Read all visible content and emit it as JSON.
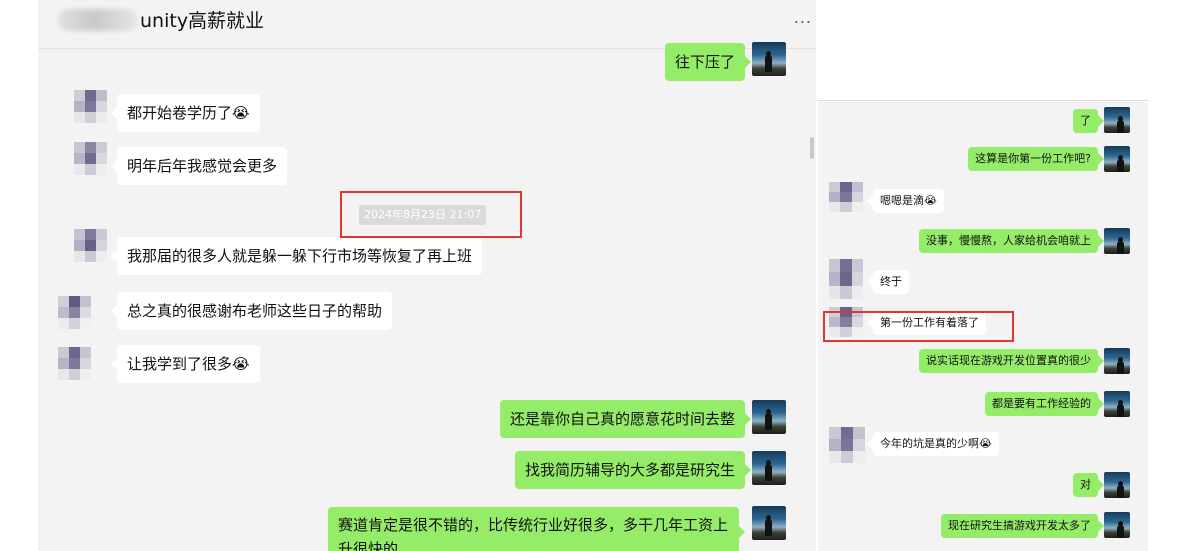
{
  "header": {
    "title": "unity高薪就业",
    "more": "..."
  },
  "left_chat": {
    "messages": [
      {
        "side": "right",
        "text": "往下压了"
      },
      {
        "side": "left",
        "text": "都开始卷学历了😭"
      },
      {
        "side": "left",
        "text": "明年后年我感觉会更多"
      },
      {
        "side": "left",
        "text": "我那届的很多人就是躲一躲下行市场等恢复了再上班"
      },
      {
        "side": "left",
        "text": "总之真的很感谢布老师这些日子的帮助"
      },
      {
        "side": "left",
        "text": "让我学到了很多😭"
      },
      {
        "side": "right",
        "text": "还是靠你自己真的愿意花时间去整"
      },
      {
        "side": "right",
        "text": "找我简历辅导的大多都是研究生"
      },
      {
        "side": "right",
        "text": "赛道肯定是很不错的，比传统行业好很多，多干几年工资上升很快的"
      }
    ],
    "timestamp": "2024年8月23日 21:07"
  },
  "right_chat": {
    "messages": [
      {
        "side": "right",
        "text": "了"
      },
      {
        "side": "right",
        "text": "这算是你第一份工作吧?"
      },
      {
        "side": "left",
        "text": "嗯嗯是滴😭"
      },
      {
        "side": "right",
        "text": "没事，慢慢熬，人家给机会咱就上"
      },
      {
        "side": "left",
        "text": "终于"
      },
      {
        "side": "left",
        "text": "第一份工作有着落了"
      },
      {
        "side": "right",
        "text": "说实话现在游戏开发位置真的很少"
      },
      {
        "side": "right",
        "text": "都是要有工作经验的"
      },
      {
        "side": "left",
        "text": "今年的坑是真的少啊😭"
      },
      {
        "side": "right",
        "text": "对"
      },
      {
        "side": "right",
        "text": "现在研究生搞游戏开发太多了"
      }
    ]
  },
  "colors": {
    "self_bubble": "#95ec69",
    "other_bubble": "#ffffff",
    "chat_bg": "#f3f3f3",
    "highlight_box": "#e1362f"
  }
}
